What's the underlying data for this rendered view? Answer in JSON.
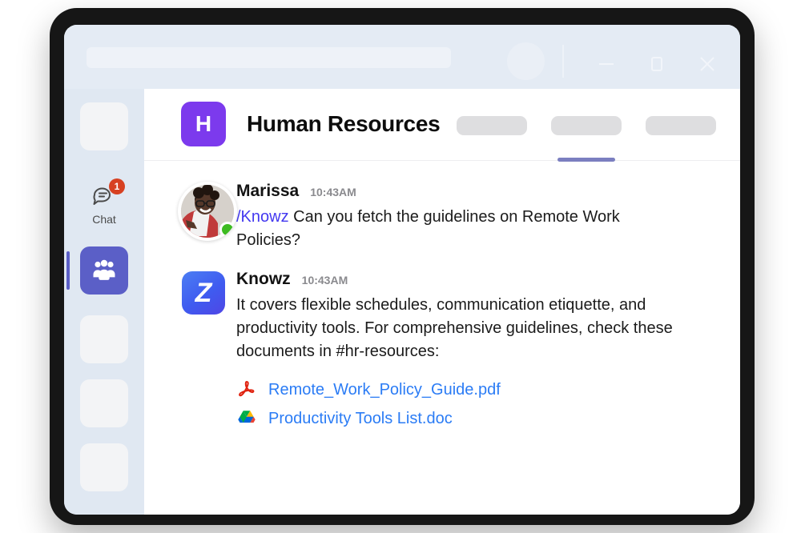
{
  "window": {
    "search_placeholder": "",
    "controls": [
      {
        "name": "minimize",
        "label": "—"
      },
      {
        "name": "maximize",
        "label": "□"
      },
      {
        "name": "close",
        "label": "✕"
      }
    ]
  },
  "rail": {
    "chat": {
      "label": "Chat",
      "badge": "1",
      "icon": "chat-bubble-icon"
    },
    "teams": {
      "label": "Teams",
      "icon": "people-group-icon",
      "active": true
    },
    "placeholders": 4
  },
  "header": {
    "team_initial": "H",
    "title": "Human Resources",
    "accent": "#7C3AED",
    "tabs": [
      {
        "label": "",
        "active": false
      },
      {
        "label": "",
        "active": true
      },
      {
        "label": "",
        "active": false
      }
    ],
    "active_underline_color": "#7B7FC0"
  },
  "messages": [
    {
      "author": "Marissa",
      "time": "10:43AM",
      "avatar": "user-photo-avatar",
      "status": "online",
      "mention": "/Knowz",
      "text": " Can you fetch the guidelines on Remote Work Policies?"
    },
    {
      "author": "Knowz",
      "time": "10:43AM",
      "avatar": "knowz-app-avatar",
      "avatar_letter": "Z",
      "text": "It covers flexible schedules, communication etiquette, and productivity tools. For comprehensive guidelines, check these documents in #hr-resources:"
    }
  ],
  "attachments": [
    {
      "name": "Remote_Work_Policy_Guide.pdf",
      "icon": "pdf-icon"
    },
    {
      "name": "Productivity Tools List.doc",
      "icon": "google-drive-icon"
    }
  ],
  "colors": {
    "link": "#2B7CF5",
    "mention": "#4338F0",
    "teams_purple": "#5B5FC7",
    "badge_red": "#D74122",
    "status_green": "#3DBB21"
  }
}
